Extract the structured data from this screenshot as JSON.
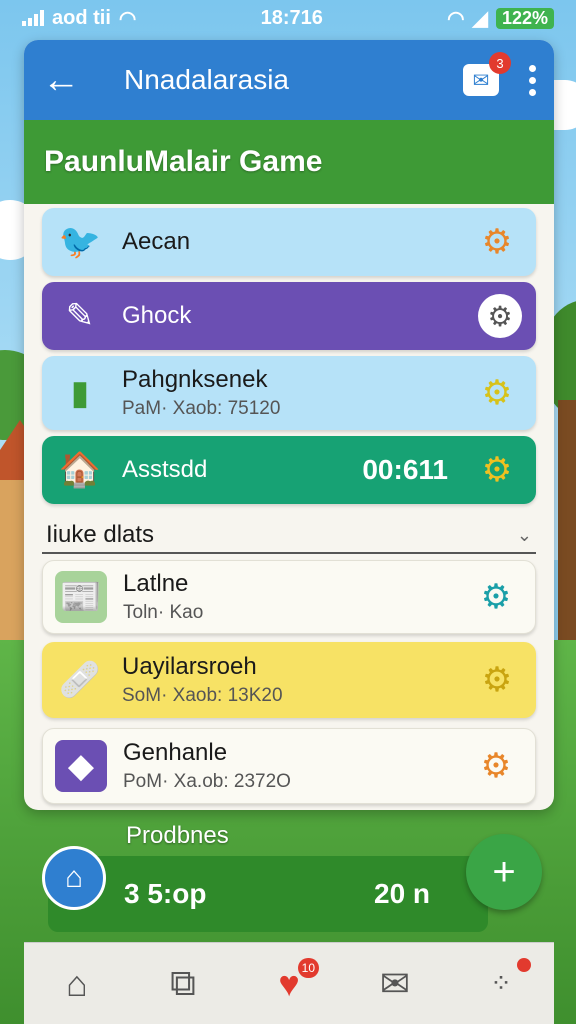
{
  "status_bar": {
    "carrier": "aod tii",
    "time": "18:716",
    "battery": "122%"
  },
  "app_bar": {
    "title": "Nnadalarasia",
    "mail_badge": "3"
  },
  "game_header": {
    "title": "PaunluMalair Game"
  },
  "items_top": [
    {
      "label": "Aecan",
      "icon": "bird-icon",
      "style": "light"
    },
    {
      "label": "Ghock",
      "icon": "paper-knife-icon",
      "style": "purple"
    },
    {
      "label": "Pahgnksenek",
      "sub": "PaM· Xaob: 75120",
      "icon": "battery-icon",
      "style": "light"
    },
    {
      "label": "Asstsdd",
      "time": "00:611",
      "icon": "house-icon",
      "style": "teal"
    }
  ],
  "section": {
    "label": "Iiuke dlats"
  },
  "items_bottom": [
    {
      "label": "Latlne",
      "sub": "Toln· Kao",
      "icon": "newspaper-icon",
      "style": "white"
    },
    {
      "label": "Uayilarsroeh",
      "sub": "SoM· Xaob: 13K20",
      "icon": "tape-icon",
      "style": "yellow"
    },
    {
      "label": "Genhanle",
      "sub": "PoM· Xa.ob: 2372O",
      "icon": "ice-pop-icon",
      "style": "white"
    }
  ],
  "progress": {
    "label": "Prodbnes",
    "value_left": "3 5:op",
    "value_right": "20 n"
  },
  "nav": {
    "heart_badge": "10"
  },
  "colors": {
    "primary": "#2f7fd0",
    "game_green": "#3e9a36",
    "purple": "#6b4fb3",
    "teal": "#17a274",
    "yellow": "#f7e265",
    "badge_red": "#e23a2e"
  }
}
